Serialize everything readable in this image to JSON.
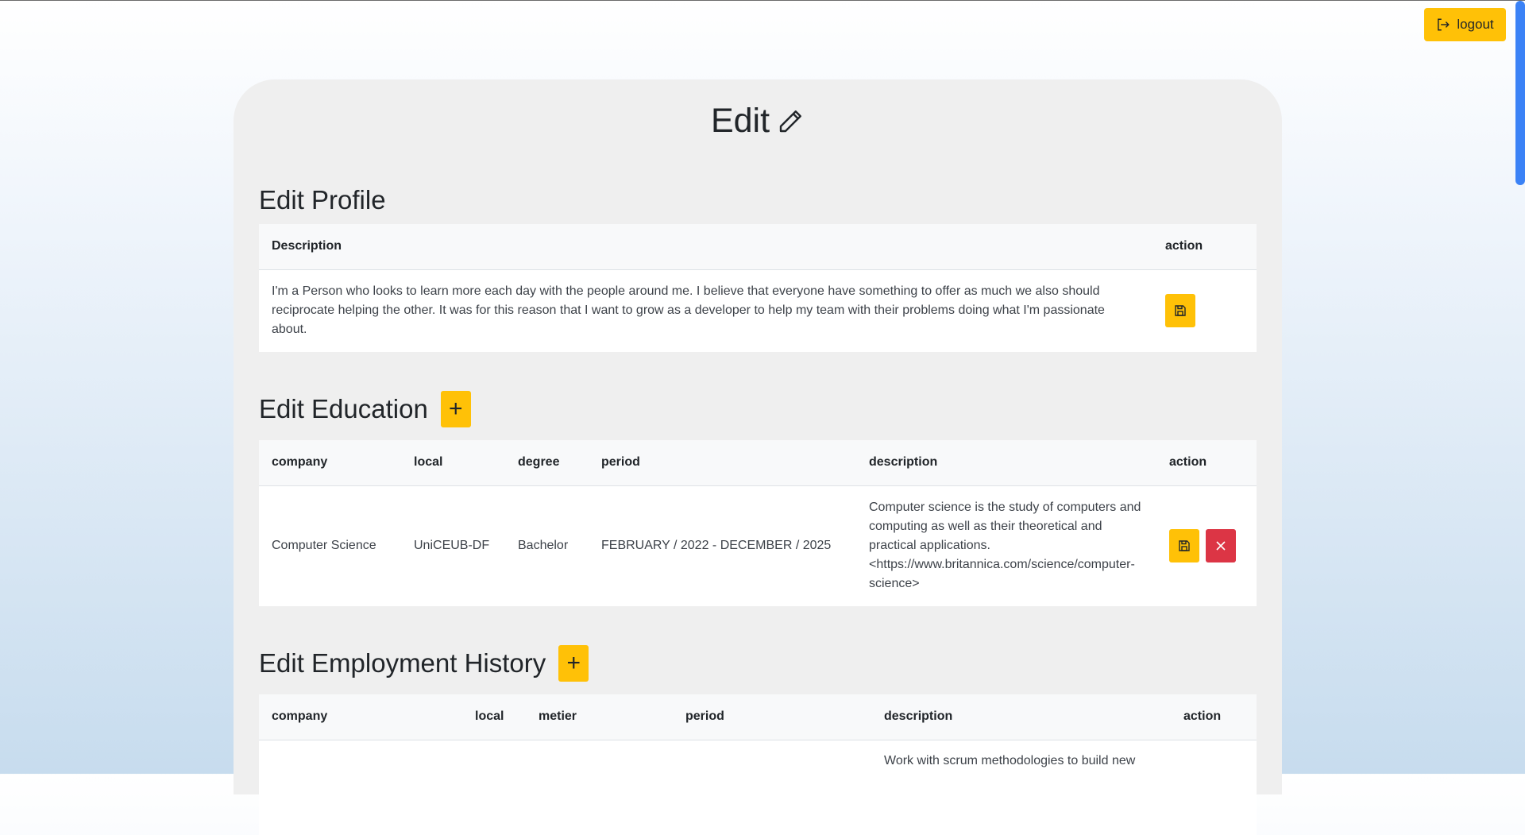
{
  "header": {
    "logout_label": "logout"
  },
  "page": {
    "title": "Edit"
  },
  "profile": {
    "title": "Edit Profile",
    "columns": [
      "Description",
      "action"
    ],
    "description": "I'm a Person who looks to learn more each day with the people around me. I believe that everyone have something to offer as much we also should reciprocate helping the other. It was for this reason that I want to grow as a developer to help my team with their problems doing what I'm passionate about."
  },
  "education": {
    "title": "Edit Education",
    "add_label": "+",
    "columns": [
      "company",
      "local",
      "degree",
      "period",
      "description",
      "action"
    ],
    "rows": [
      {
        "company": "Computer Science",
        "local": "UniCEUB-DF",
        "degree": "Bachelor",
        "period": "FEBRUARY / 2022 - DECEMBER / 2025",
        "description": "Computer science is the study of computers and computing as well as their theoretical and practical applications. <https://www.britannica.com/science/computer-science>"
      }
    ]
  },
  "employment": {
    "title": "Edit Employment History",
    "add_label": "+",
    "columns": [
      "company",
      "local",
      "metier",
      "period",
      "description",
      "action"
    ],
    "rows": [
      {
        "company": "",
        "local": "",
        "metier": "",
        "period": "",
        "description": "Work with scrum methodologies to build new"
      }
    ]
  },
  "colors": {
    "accent": "#ffc107",
    "danger": "#dc3545",
    "scrollbar": "#3b82f6"
  },
  "icons": {
    "logout": "logout-icon",
    "title": "pencil-icon",
    "save": "save-icon",
    "delete": "close-icon",
    "add": "plus-icon"
  }
}
